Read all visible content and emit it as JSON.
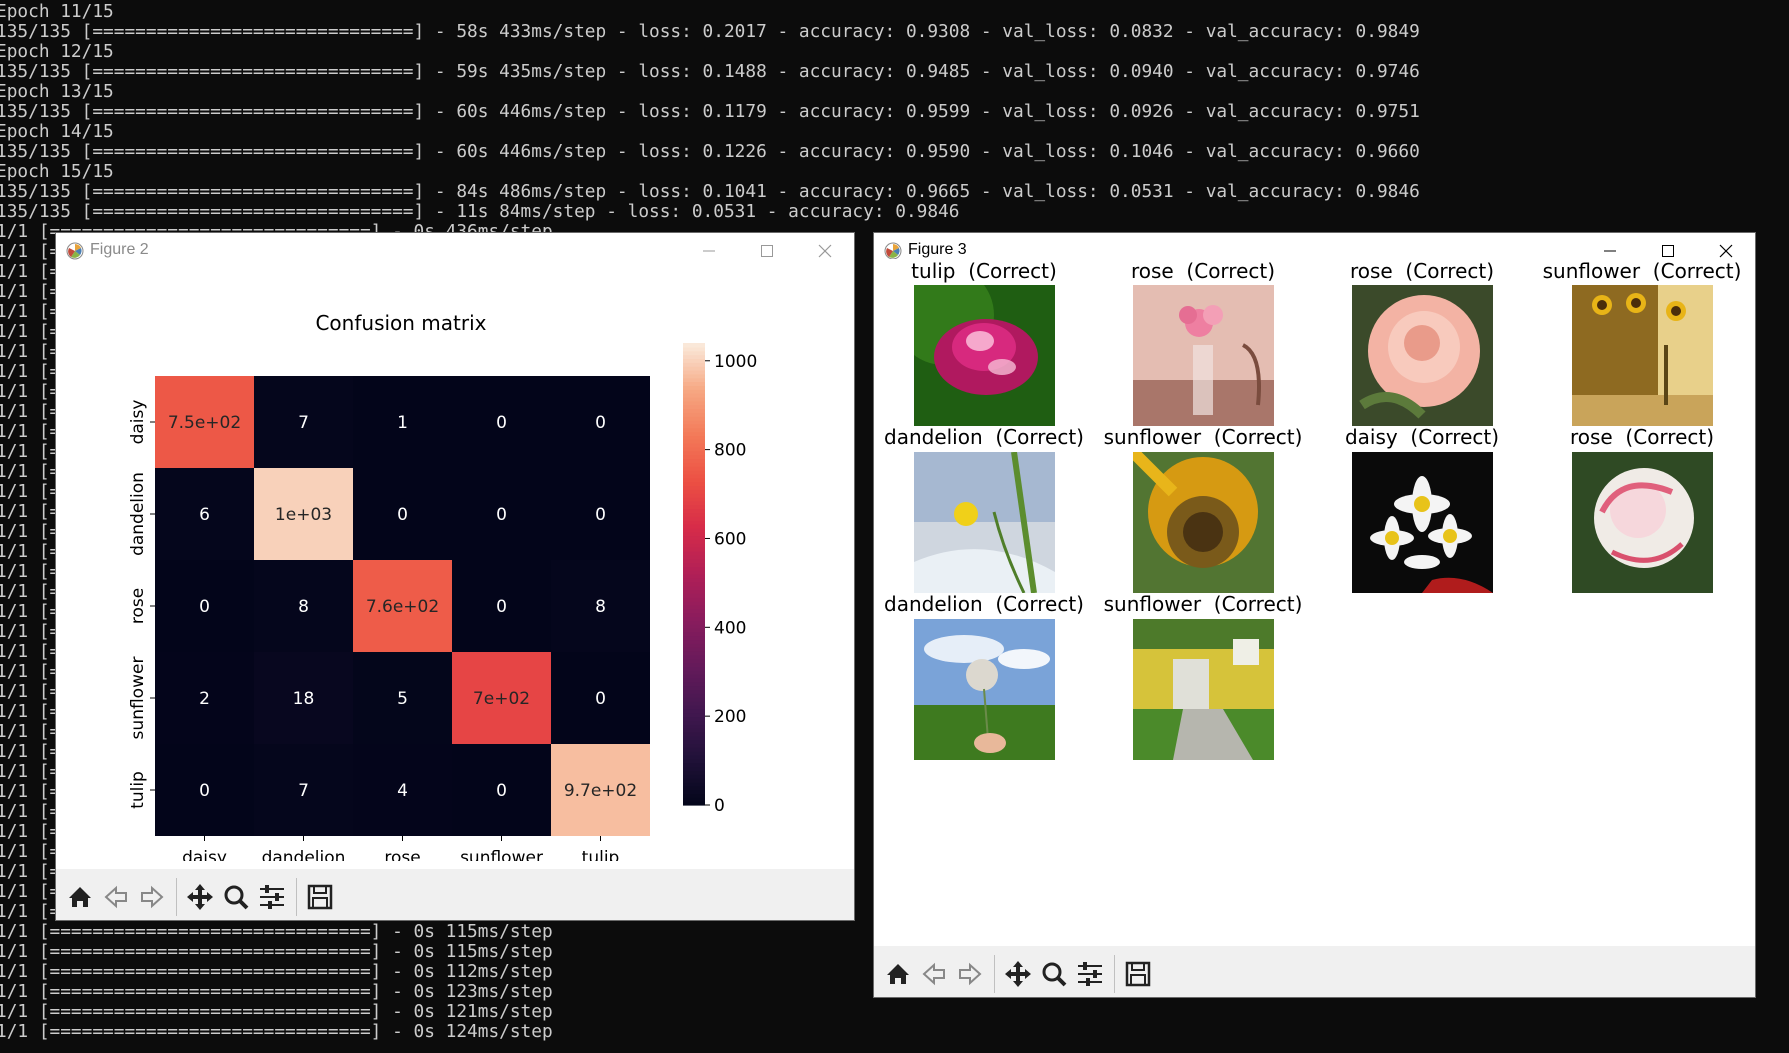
{
  "terminal": {
    "lines": [
      "Epoch 11/15",
      "135/135 [==============================] - 58s 433ms/step - loss: 0.2017 - accuracy: 0.9308 - val_loss: 0.0832 - val_accuracy: 0.9849",
      "Epoch 12/15",
      "135/135 [==============================] - 59s 435ms/step - loss: 0.1488 - accuracy: 0.9485 - val_loss: 0.0940 - val_accuracy: 0.9746",
      "Epoch 13/15",
      "135/135 [==============================] - 60s 446ms/step - loss: 0.1179 - accuracy: 0.9599 - val_loss: 0.0926 - val_accuracy: 0.9751",
      "Epoch 14/15",
      "135/135 [==============================] - 60s 446ms/step - loss: 0.1226 - accuracy: 0.9590 - val_loss: 0.1046 - val_accuracy: 0.9660",
      "Epoch 15/15",
      "135/135 [==============================] - 84s 486ms/step - loss: 0.1041 - accuracy: 0.9665 - val_loss: 0.0531 - val_accuracy: 0.9846",
      "135/135 [==============================] - 11s 84ms/step - loss: 0.0531 - accuracy: 0.9846",
      "1/1 [==============================] - 0s 436ms/step"
    ],
    "bottom_lines": [
      "1/1 [==============================] - 0s 115ms/step",
      "1/1 [==============================] - 0s 115ms/step",
      "1/1 [==============================] - 0s 112ms/step",
      "1/1 [==============================] - 0s 123ms/step",
      "1/1 [==============================] - 0s 121ms/step",
      "1/1 [==============================] - 0s 124ms/step"
    ],
    "left_fragment": "1/1 [="
  },
  "figure2": {
    "window_title": "Figure 2",
    "chart_data": {
      "type": "heatmap",
      "title": "Confusion matrix",
      "x_labels": [
        "daisy",
        "dandelion",
        "rose",
        "sunflower",
        "tulip"
      ],
      "y_labels": [
        "daisy",
        "dandelion",
        "rose",
        "sunflower",
        "tulip"
      ],
      "values": [
        [
          750,
          7,
          1,
          0,
          0
        ],
        [
          6,
          1000,
          0,
          0,
          0
        ],
        [
          0,
          8,
          760,
          0,
          8
        ],
        [
          2,
          18,
          5,
          700,
          0
        ],
        [
          0,
          7,
          4,
          0,
          970
        ]
      ],
      "cell_labels": [
        [
          "7.5e+02",
          "7",
          "1",
          "0",
          "0"
        ],
        [
          "6",
          "1e+03",
          "0",
          "0",
          "0"
        ],
        [
          "0",
          "8",
          "7.6e+02",
          "0",
          "8"
        ],
        [
          "2",
          "18",
          "5",
          "7e+02",
          "0"
        ],
        [
          "0",
          "7",
          "4",
          "0",
          "9.7e+02"
        ]
      ],
      "colorbar": {
        "ticks": [
          0,
          200,
          400,
          600,
          800,
          1000
        ],
        "range": [
          0,
          1040
        ],
        "colormap": "rocket"
      }
    }
  },
  "figure3": {
    "window_title": "Figure 3",
    "panels": [
      {
        "title": "tulip  (Correct)",
        "subject": "tulip"
      },
      {
        "title": "rose  (Correct)",
        "subject": "rose-vase"
      },
      {
        "title": "rose  (Correct)",
        "subject": "rose-pink"
      },
      {
        "title": "sunflower  (Correct)",
        "subject": "sunflower-window"
      },
      {
        "title": "dandelion  (Correct)",
        "subject": "dandelion"
      },
      {
        "title": "sunflower  (Correct)",
        "subject": "sunflower-closeup"
      },
      {
        "title": "daisy  (Correct)",
        "subject": "daisy"
      },
      {
        "title": "rose  (Correct)",
        "subject": "rose-white"
      },
      {
        "title": "dandelion  (Correct)",
        "subject": "dandelion-seed"
      },
      {
        "title": "sunflower  (Correct)",
        "subject": "sunflower-house"
      }
    ]
  },
  "toolbar_icons": [
    "home-icon",
    "back-arrow-icon",
    "forward-arrow-icon",
    "pan-icon",
    "zoom-icon",
    "configure-subplots-icon",
    "save-icon"
  ],
  "colors": {
    "terminal_bg": "#0c0c0c",
    "terminal_fg": "#cccccc",
    "toolbar_bg": "#f0f0f0",
    "heat_low": "#03051a",
    "heat_high": "#faebdd"
  }
}
